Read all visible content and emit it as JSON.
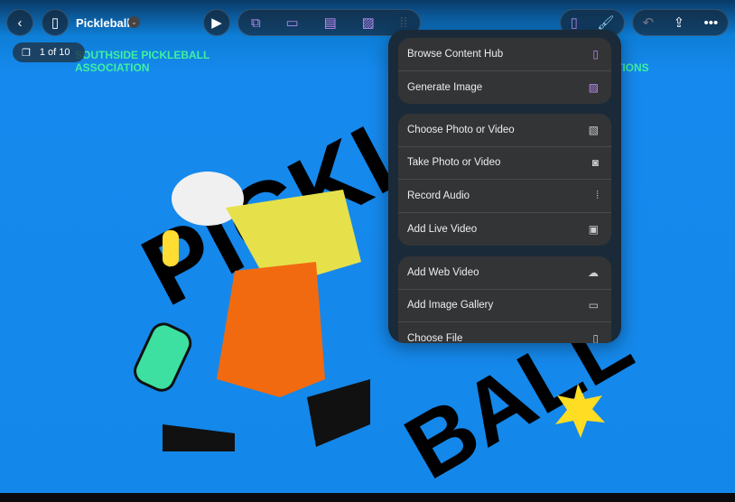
{
  "header": {
    "title": "Pickleball",
    "back": "chevron-left-icon",
    "sidebar": "sidebar-icon",
    "play": "play-icon",
    "more": "•••"
  },
  "toolbar_media": [
    "content-hub-icon",
    "generate-layout-icon",
    "generate-slide-icon",
    "generate-image-icon"
  ],
  "pager": {
    "label": "1 of 10"
  },
  "slide": {
    "org_line1": "SOUTHSIDE PICKLEBALL",
    "org_line2": "ASSOCIATION",
    "org_right": "TIONS",
    "word1": "PICKLE",
    "word2": "BALL"
  },
  "menu": {
    "groups": [
      [
        {
          "label": "Browse Content Hub",
          "icon": "content-hub-icon"
        },
        {
          "label": "Generate Image",
          "icon": "generate-image-icon"
        }
      ],
      [
        {
          "label": "Choose Photo or Video",
          "icon": "photo-library-icon"
        },
        {
          "label": "Take Photo or Video",
          "icon": "camera-icon"
        },
        {
          "label": "Record Audio",
          "icon": "waveform-icon"
        },
        {
          "label": "Add Live Video",
          "icon": "video-camera-icon"
        }
      ],
      [
        {
          "label": "Add Web Video",
          "icon": "cloud-play-icon"
        },
        {
          "label": "Add Image Gallery",
          "icon": "gallery-icon"
        },
        {
          "label": "Choose File",
          "icon": "document-icon"
        }
      ]
    ]
  },
  "colors": {
    "accent": "#b98cf0",
    "background": "#1689ee",
    "org_text": "#3ef0a0"
  }
}
